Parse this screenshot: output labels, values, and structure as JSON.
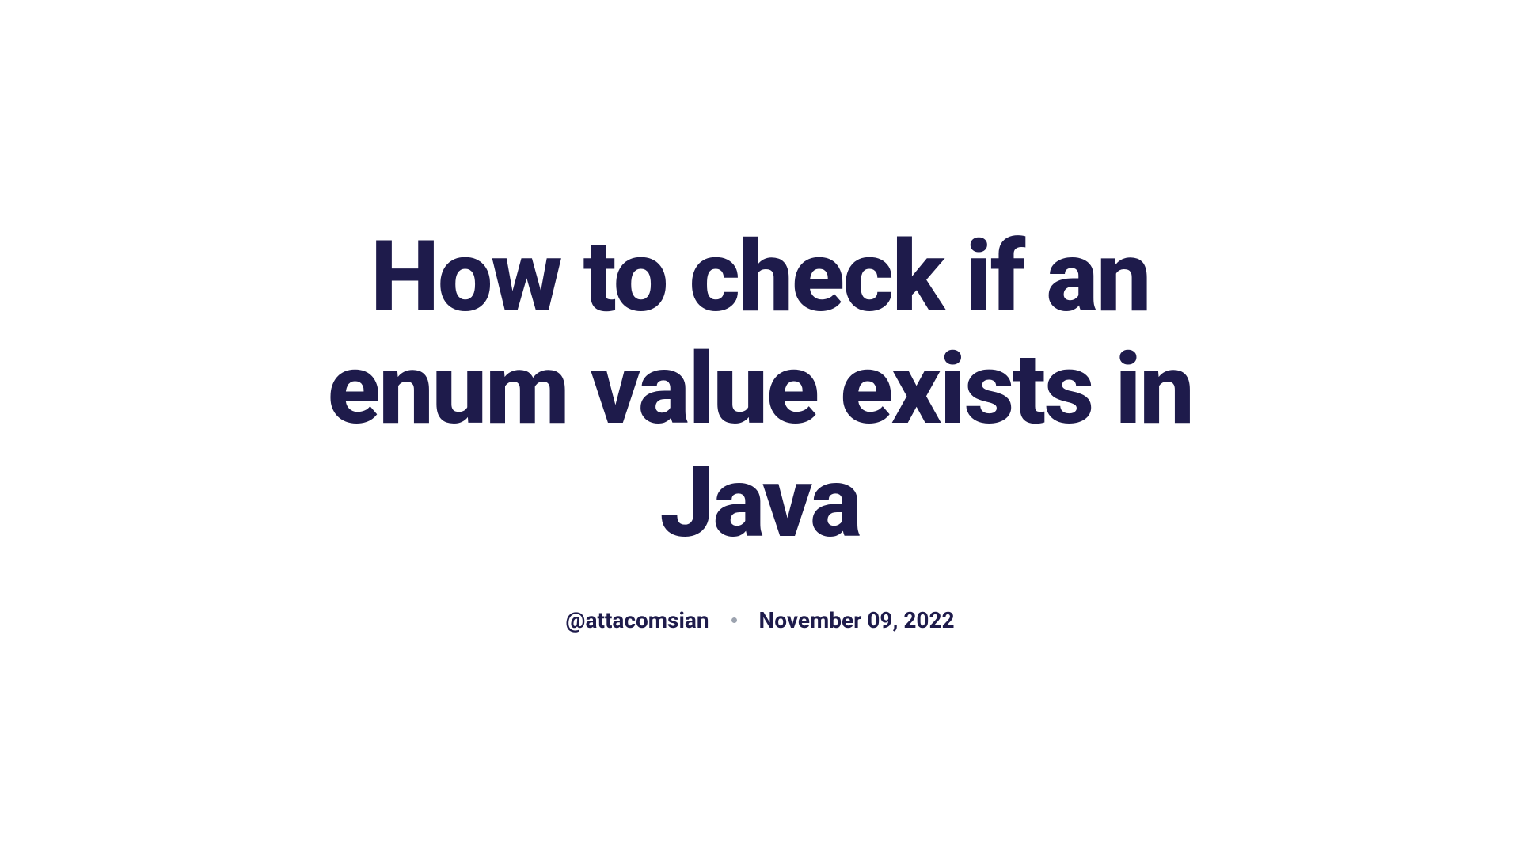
{
  "article": {
    "title": "How to check if an enum value exists in Java",
    "author": "@attacomsian",
    "date": "November 09, 2022"
  }
}
